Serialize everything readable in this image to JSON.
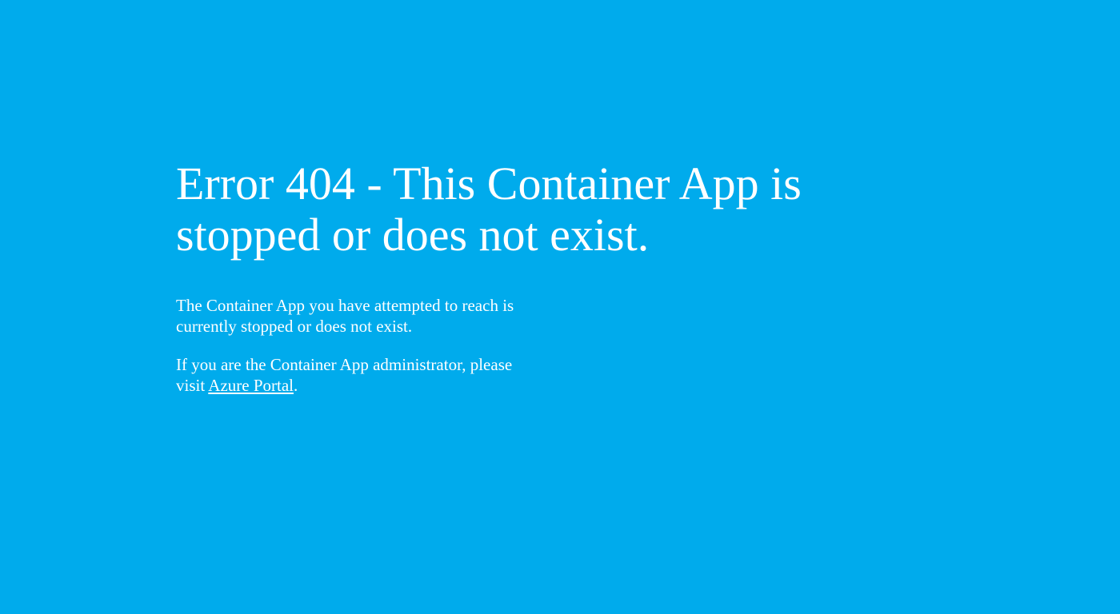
{
  "colors": {
    "background": "#00abec",
    "text": "#ffffff"
  },
  "heading": "Error 404 - This Container App is stopped or does not exist.",
  "message": "The Container App you have attempted to reach is currently stopped or does not exist.",
  "admin_prefix": "If you are the Container App administrator, please visit ",
  "admin_link_text": "Azure Portal",
  "admin_suffix": "."
}
